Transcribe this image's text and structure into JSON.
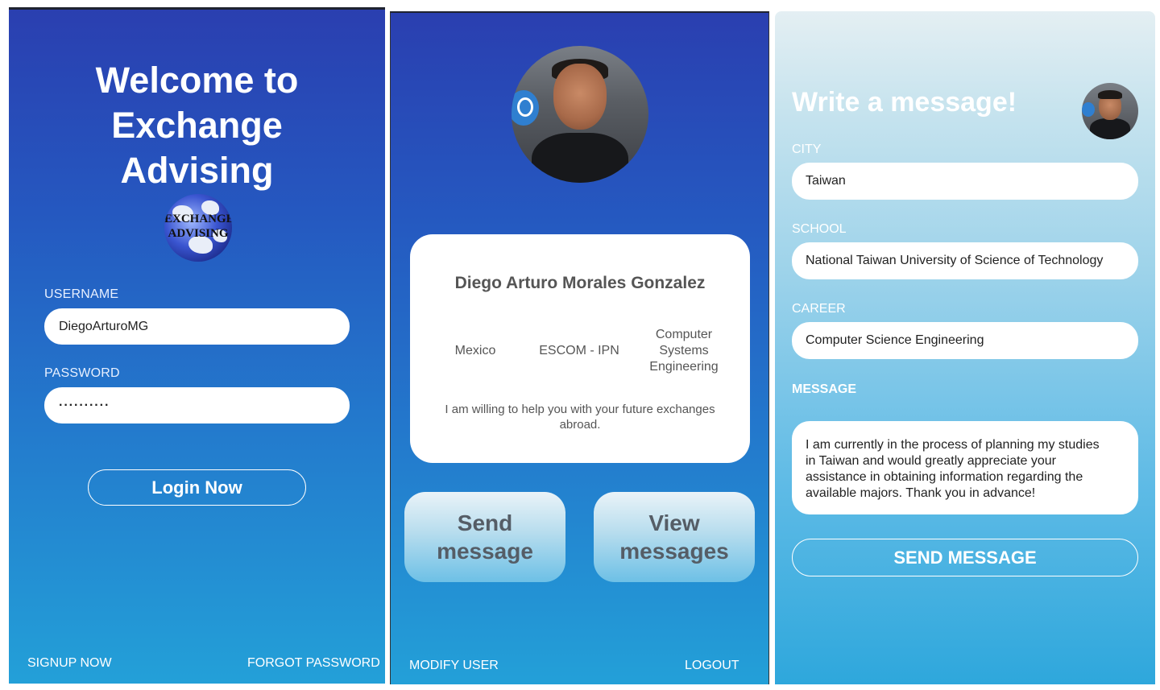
{
  "login": {
    "welcome_line1": "Welcome to Exchange",
    "welcome_line2": "Advising",
    "logo_text1": "EXCHANGE",
    "logo_text2": "ADVISING",
    "username_label": "USERNAME",
    "username_value": "DiegoArturoMG",
    "password_label": "PASSWORD",
    "password_value": "··········",
    "login_button": "Login Now",
    "signup_link": "SIGNUP NOW",
    "forgot_link": "FORGOT PASSWORD"
  },
  "profile": {
    "name": "Diego Arturo Morales Gonzalez",
    "country": "Mexico",
    "school": "ESCOM - IPN",
    "career_line1": "Computer",
    "career_line2": "Systems",
    "career_line3": "Engineering",
    "bio_line1": "I am willing to help you with your future exchanges",
    "bio_line2": "abroad.",
    "send_line1": "Send",
    "send_line2": "message",
    "view_line1": "View",
    "view_line2": "messages",
    "modify_link": "MODIFY USER",
    "logout_link": "LOGOUT"
  },
  "compose": {
    "title": "Write a message!",
    "city_label": "CITY",
    "city_value": "Taiwan",
    "school_label": "SCHOOL",
    "school_value": "National Taiwan University of Science of Technology",
    "career_label": "CAREER",
    "career_value": "Computer Science Engineering",
    "message_label": "MESSAGE",
    "message_line1": "I am currently in the process of planning my studies",
    "message_line2": "in Taiwan and would greatly appreciate your",
    "message_line3": "assistance in obtaining information regarding the",
    "message_line4": "available majors. Thank you in advance!",
    "send_button": "SEND MESSAGE"
  }
}
